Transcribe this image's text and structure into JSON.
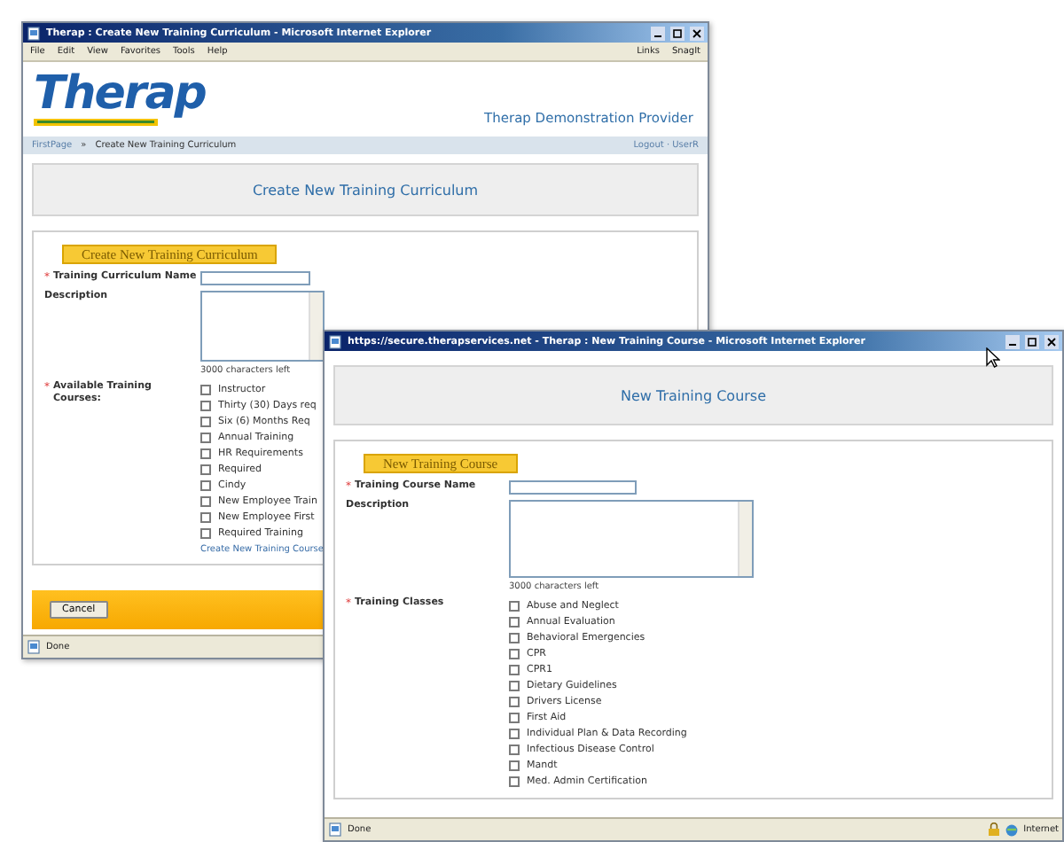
{
  "back_window": {
    "title": "Therap : Create New Training Curriculum - Microsoft Internet Explorer",
    "menu": [
      "File",
      "Edit",
      "View",
      "Favorites",
      "Tools",
      "Help"
    ],
    "toolbar_links": [
      "Links",
      "SnagIt"
    ],
    "logo": "Therap",
    "provider": "Therap Demonstration Provider",
    "breadcrumb": {
      "home": "FirstPage",
      "separator": "»",
      "current": "Create New Training Curriculum"
    },
    "user_links": "Logout · UserR",
    "heading": "Create New Training Curriculum",
    "form": {
      "legend": "Create New Training Curriculum",
      "fields": [
        {
          "kind": "text",
          "marker": "*",
          "label": "Training Curriculum Name"
        },
        {
          "kind": "textarea",
          "label": "Description",
          "counter": "3000 characters left"
        },
        {
          "kind": "checklist",
          "marker": "*",
          "label": "Available Training Courses:",
          "items": [
            {
              "label": "Instructor",
              "checked": false
            },
            {
              "label": "Thirty (30) Days req",
              "checked": false
            },
            {
              "label": "Six (6) Months Req",
              "checked": false
            },
            {
              "label": "Annual Training",
              "checked": false
            },
            {
              "label": "HR Requirements",
              "checked": false
            },
            {
              "label": "Required",
              "checked": false
            },
            {
              "label": "Cindy",
              "checked": false
            },
            {
              "label": "New Employee Train",
              "checked": false
            },
            {
              "label": "New Employee First",
              "checked": false
            },
            {
              "label": "Required Training",
              "checked": false
            }
          ],
          "link": "Create New Training Course"
        }
      ]
    },
    "buttons": [
      "Cancel"
    ],
    "status": "Done"
  },
  "front_window": {
    "title": "https://secure.therapservices.net - Therap : New Training Course - Microsoft Internet Explorer",
    "heading": "New Training Course",
    "form": {
      "legend": "New Training Course",
      "fields": [
        {
          "kind": "text",
          "marker": "*",
          "label": "Training Course Name"
        },
        {
          "kind": "textarea",
          "label": "Description",
          "counter": "3000 characters left"
        },
        {
          "kind": "checklist",
          "marker": "*",
          "label": "Training Classes",
          "items": [
            {
              "label": "Abuse and Neglect",
              "checked": false
            },
            {
              "label": "Annual Evaluation",
              "checked": false
            },
            {
              "label": "Behavioral Emergencies",
              "checked": false
            },
            {
              "label": "CPR",
              "checked": false
            },
            {
              "label": "CPR1",
              "checked": false
            },
            {
              "label": "Dietary Guidelines",
              "checked": false
            },
            {
              "label": "Drivers License",
              "checked": false
            },
            {
              "label": "First Aid",
              "checked": false
            },
            {
              "label": "Individual Plan & Data Recording",
              "checked": false
            },
            {
              "label": "Infectious Disease Control",
              "checked": false
            },
            {
              "label": "Mandt",
              "checked": false
            },
            {
              "label": "Med. Admin Certification",
              "checked": false
            }
          ]
        }
      ]
    },
    "status": "Done",
    "zone": "Internet"
  }
}
